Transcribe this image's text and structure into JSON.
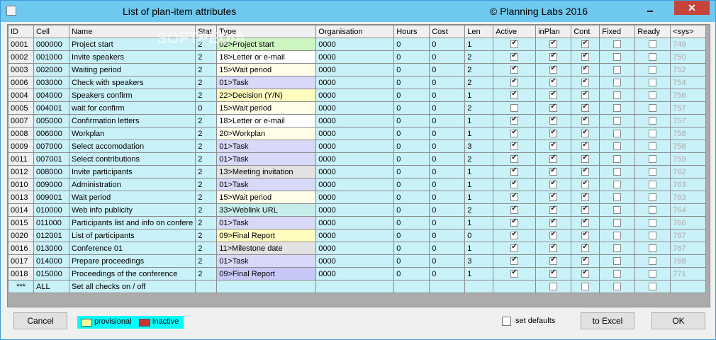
{
  "window": {
    "title": "List of plan-item attributes",
    "copyright": "© Planning Labs 2016",
    "close": "✕"
  },
  "watermark": "SOFTPEDIA",
  "columns": [
    "ID",
    "Cell",
    "Name",
    "Stat",
    "Type",
    "Organisation",
    "Hours",
    "Cost",
    "Len",
    "Active",
    "inPlan",
    "Cont",
    "Fixed",
    "Ready",
    "<sys>"
  ],
  "rows": [
    {
      "id": "0001",
      "cell": "000000",
      "name": "Project start",
      "stat": "2",
      "type": "02>Project start",
      "type_color": "#cdf5c0",
      "org": "0000",
      "hours": "0",
      "cost": "0",
      "len": "1",
      "active": true,
      "inplan": true,
      "cont": true,
      "fixed": false,
      "ready": false,
      "sys": "749"
    },
    {
      "id": "0002",
      "cell": "001000",
      "name": "Invite speakers",
      "stat": "2",
      "type": "18>Letter or e-mail",
      "type_color": "#ffffff",
      "org": "0000",
      "hours": "0",
      "cost": "0",
      "len": "2",
      "active": true,
      "inplan": true,
      "cont": true,
      "fixed": false,
      "ready": false,
      "sys": "750"
    },
    {
      "id": "0003",
      "cell": "002000",
      "name": "Waiting period",
      "stat": "2",
      "type": "15>Wait period",
      "type_color": "#fffde8",
      "org": "0000",
      "hours": "0",
      "cost": "0",
      "len": "2",
      "active": true,
      "inplan": true,
      "cont": true,
      "fixed": false,
      "ready": false,
      "sys": "752"
    },
    {
      "id": "0006",
      "cell": "003000",
      "name": "Check with speakers",
      "stat": "2",
      "type": "01>Task",
      "type_color": "#d8d8f8",
      "org": "0000",
      "hours": "0",
      "cost": "0",
      "len": "2",
      "active": true,
      "inplan": true,
      "cont": true,
      "fixed": false,
      "ready": false,
      "sys": "754"
    },
    {
      "id": "0004",
      "cell": "004000",
      "name": "Speakers confirm",
      "stat": "2",
      "type": "22>Decision (Y/N)",
      "type_color": "#fffcc0",
      "org": "0000",
      "hours": "0",
      "cost": "0",
      "len": "1",
      "active": true,
      "inplan": true,
      "cont": true,
      "fixed": false,
      "ready": false,
      "sys": "756"
    },
    {
      "id": "0005",
      "cell": "004001",
      "name": "wait for confirm",
      "stat": "0",
      "type": "15>Wait period",
      "type_color": "#fffde8",
      "org": "0000",
      "hours": "0",
      "cost": "0",
      "len": "2",
      "active": false,
      "inplan": true,
      "cont": true,
      "fixed": false,
      "ready": false,
      "sys": "757"
    },
    {
      "id": "0007",
      "cell": "005000",
      "name": "Confirmation letters",
      "stat": "2",
      "type": "18>Letter or e-mail",
      "type_color": "#ffffff",
      "org": "0000",
      "hours": "0",
      "cost": "0",
      "len": "1",
      "active": true,
      "inplan": true,
      "cont": true,
      "fixed": false,
      "ready": false,
      "sys": "757"
    },
    {
      "id": "0008",
      "cell": "006000",
      "name": "Workplan",
      "stat": "2",
      "type": "20>Workplan",
      "type_color": "#fffde8",
      "org": "0000",
      "hours": "0",
      "cost": "0",
      "len": "1",
      "active": true,
      "inplan": true,
      "cont": true,
      "fixed": false,
      "ready": false,
      "sys": "758"
    },
    {
      "id": "0009",
      "cell": "007000",
      "name": "Select accomodation",
      "stat": "2",
      "type": "01>Task",
      "type_color": "#d8d8f8",
      "org": "0000",
      "hours": "0",
      "cost": "0",
      "len": "3",
      "active": true,
      "inplan": true,
      "cont": true,
      "fixed": false,
      "ready": false,
      "sys": "758"
    },
    {
      "id": "0011",
      "cell": "007001",
      "name": "Select contributions",
      "stat": "2",
      "type": "01>Task",
      "type_color": "#d8d8f8",
      "org": "0000",
      "hours": "0",
      "cost": "0",
      "len": "2",
      "active": true,
      "inplan": true,
      "cont": true,
      "fixed": false,
      "ready": false,
      "sys": "759"
    },
    {
      "id": "0012",
      "cell": "008000",
      "name": "Invite participants",
      "stat": "2",
      "type": "13>Meeting invitation",
      "type_color": "#e2e2e2",
      "org": "0000",
      "hours": "0",
      "cost": "0",
      "len": "1",
      "active": true,
      "inplan": true,
      "cont": true,
      "fixed": false,
      "ready": false,
      "sys": "762"
    },
    {
      "id": "0010",
      "cell": "009000",
      "name": "Administration",
      "stat": "2",
      "type": "01>Task",
      "type_color": "#d8d8f8",
      "org": "0000",
      "hours": "0",
      "cost": "0",
      "len": "1",
      "active": true,
      "inplan": true,
      "cont": true,
      "fixed": false,
      "ready": false,
      "sys": "763"
    },
    {
      "id": "0013",
      "cell": "009001",
      "name": "Wait period",
      "stat": "2",
      "type": "15>Wait period",
      "type_color": "#fffde8",
      "org": "0000",
      "hours": "0",
      "cost": "0",
      "len": "1",
      "active": true,
      "inplan": true,
      "cont": true,
      "fixed": false,
      "ready": false,
      "sys": "763"
    },
    {
      "id": "0014",
      "cell": "010000",
      "name": "Web info publicity",
      "stat": "2",
      "type": "33>Weblink URL",
      "type_color": "#c8ecec",
      "org": "0000",
      "hours": "0",
      "cost": "0",
      "len": "2",
      "active": true,
      "inplan": true,
      "cont": true,
      "fixed": false,
      "ready": false,
      "sys": "764"
    },
    {
      "id": "0015",
      "cell": "011000",
      "name": "Participants list and info on confere",
      "stat": "2",
      "type": "01>Task",
      "type_color": "#d8d8f8",
      "org": "0000",
      "hours": "0",
      "cost": "0",
      "len": "1",
      "active": true,
      "inplan": true,
      "cont": true,
      "fixed": false,
      "ready": false,
      "sys": "766"
    },
    {
      "id": "0020",
      "cell": "012001",
      "name": "List of participants",
      "stat": "2",
      "type": "09>Final Report",
      "type_color": "#fffcc0",
      "org": "0000",
      "hours": "0",
      "cost": "0",
      "len": "0",
      "active": true,
      "inplan": true,
      "cont": true,
      "fixed": false,
      "ready": false,
      "sys": "767"
    },
    {
      "id": "0016",
      "cell": "013000",
      "name": "Conference 01",
      "stat": "2",
      "type": "11>Milestone date",
      "type_color": "#e2e2e2",
      "org": "0000",
      "hours": "0",
      "cost": "0",
      "len": "1",
      "active": true,
      "inplan": true,
      "cont": true,
      "fixed": false,
      "ready": false,
      "sys": "767"
    },
    {
      "id": "0017",
      "cell": "014000",
      "name": "Prepare proceedings",
      "stat": "2",
      "type": "01>Task",
      "type_color": "#d8d8f8",
      "org": "0000",
      "hours": "0",
      "cost": "0",
      "len": "3",
      "active": true,
      "inplan": true,
      "cont": true,
      "fixed": false,
      "ready": false,
      "sys": "768"
    },
    {
      "id": "0018",
      "cell": "015000",
      "name": "Proceedings of the conference",
      "stat": "2",
      "type": "09>Final Report",
      "type_color": "#c8c8f8",
      "org": "0000",
      "hours": "0",
      "cost": "0",
      "len": "1",
      "active": true,
      "inplan": true,
      "cont": true,
      "fixed": false,
      "ready": false,
      "sys": "771"
    }
  ],
  "all_row": {
    "id": "***",
    "cell": "ALL",
    "name": "Set all checks  on / off"
  },
  "footer": {
    "cancel": "Cancel",
    "legend_provisional": "provisional",
    "legend_inactive": "inactive",
    "legend_provisional_color": "#ffff99",
    "legend_inactive_color": "#cc3333",
    "set_defaults": "set defaults",
    "to_excel": "to  Excel",
    "ok": "OK"
  }
}
